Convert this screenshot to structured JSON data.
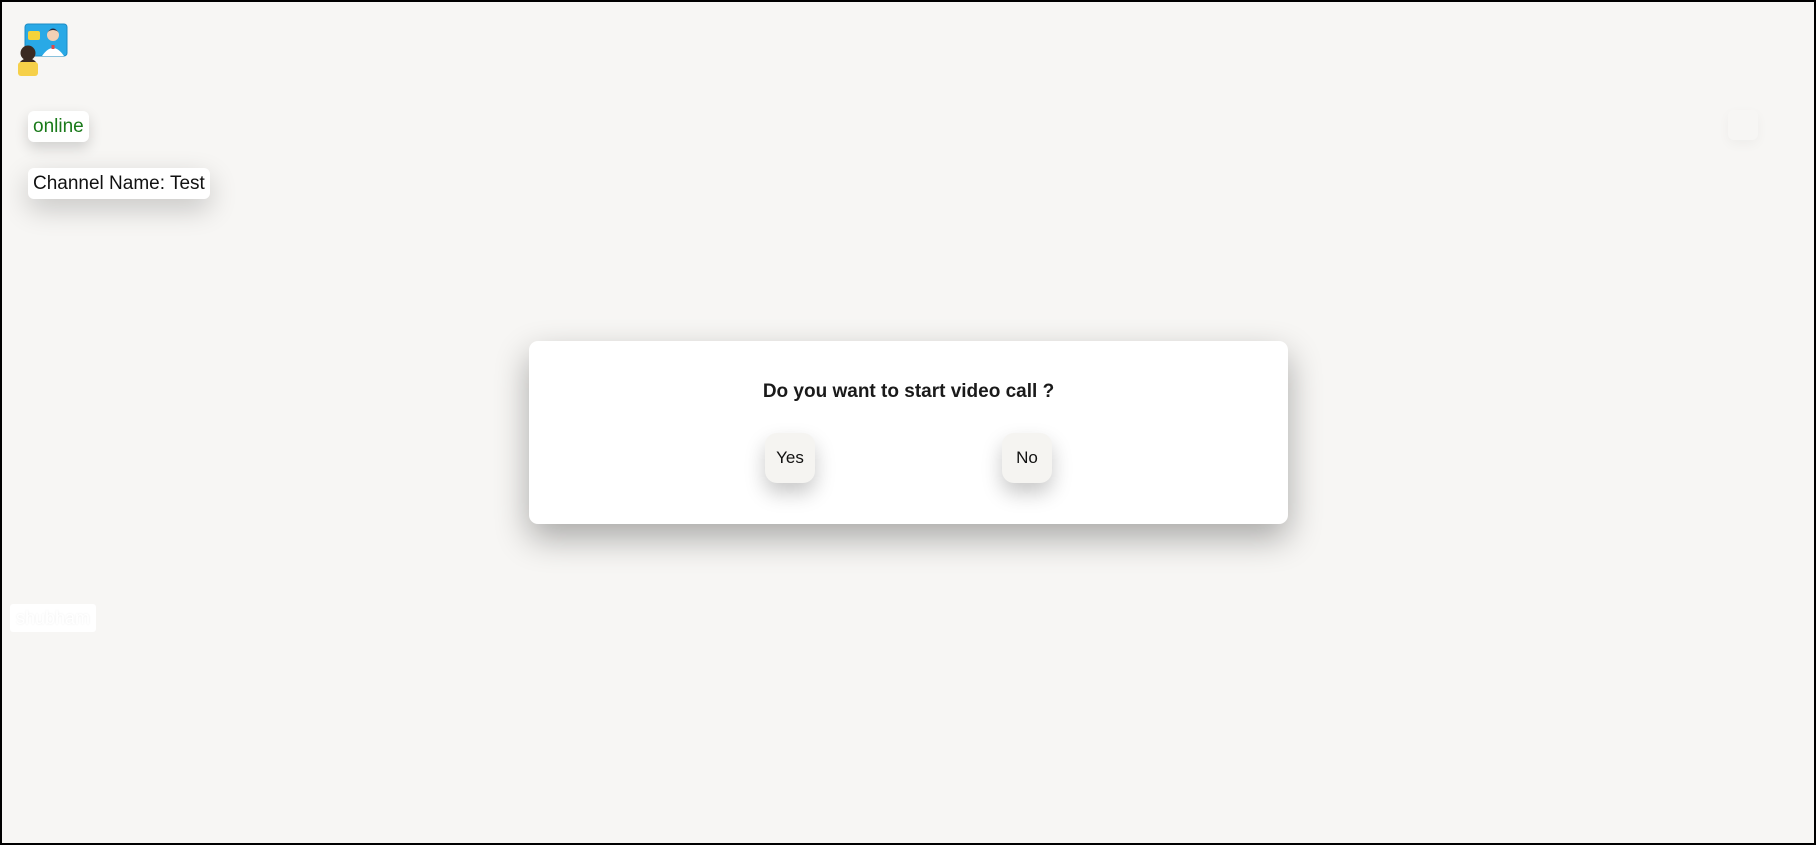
{
  "status": {
    "text": "online",
    "color": "#1a7a1a"
  },
  "channel": {
    "label": "Channel Name: Test"
  },
  "user": {
    "name": "shubham"
  },
  "dialog": {
    "question": "Do you want to start video call ?",
    "yes_label": "Yes",
    "no_label": "No"
  },
  "icons": {
    "logo": "video-call-logo-icon"
  }
}
